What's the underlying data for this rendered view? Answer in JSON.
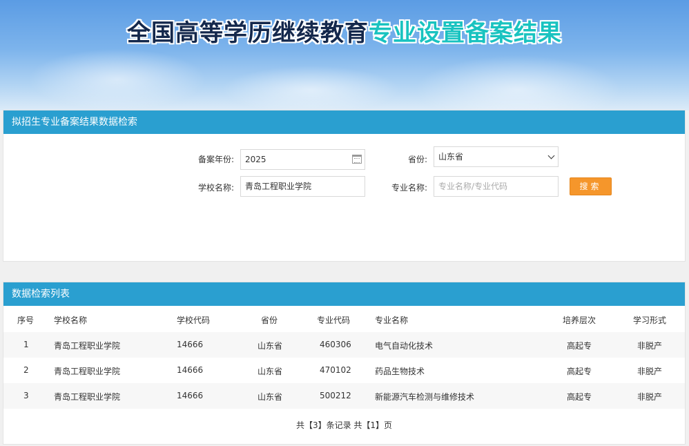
{
  "banner": {
    "title_part1": "全国高等学历继续教育",
    "title_part2": "专业设置备案结果"
  },
  "search": {
    "header": "拟招生专业备案结果数据检索",
    "year_label": "备案年份:",
    "year_value": "2025",
    "province_label": "省份:",
    "province_value": "山东省",
    "school_label": "学校名称:",
    "school_value": "青岛工程职业学院",
    "major_label": "专业名称:",
    "major_placeholder": "专业名称/专业代码",
    "button_label": "搜索"
  },
  "list": {
    "header": "数据检索列表",
    "columns": [
      "序号",
      "学校名称",
      "学校代码",
      "省份",
      "专业代码",
      "专业名称",
      "培养层次",
      "学习形式"
    ],
    "rows": [
      [
        "1",
        "青岛工程职业学院",
        "14666",
        "山东省",
        "460306",
        "电气自动化技术",
        "高起专",
        "非脱产"
      ],
      [
        "2",
        "青岛工程职业学院",
        "14666",
        "山东省",
        "470102",
        "药品生物技术",
        "高起专",
        "非脱产"
      ],
      [
        "3",
        "青岛工程职业学院",
        "14666",
        "山东省",
        "500212",
        "新能源汽车检测与维修技术",
        "高起专",
        "非脱产"
      ]
    ],
    "pager": "共【3】条记录 共【1】页"
  },
  "colors": {
    "header_bar": "#2a9fd0",
    "button": "#f5962b",
    "title_dark": "#14284c",
    "title_teal": "#19c3c0"
  }
}
